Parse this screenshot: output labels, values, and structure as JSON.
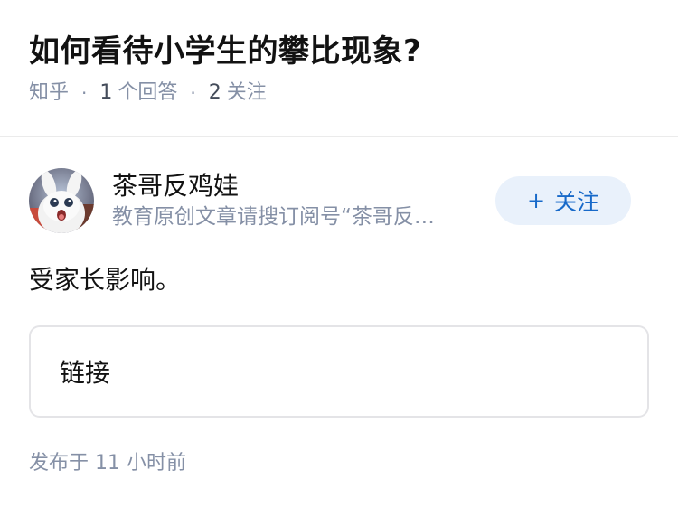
{
  "question": {
    "title": "如何看待小学生的攀比现象?",
    "source": "知乎",
    "answer_count": "1",
    "answer_label": "个回答",
    "follower_count": "2",
    "follower_label": "关注"
  },
  "answer": {
    "author": {
      "name": "茶哥反鸡娃",
      "headline": "教育原创文章请搜订阅号“茶哥反…",
      "avatar": "white-bunny-avatar"
    },
    "follow_button": {
      "icon": "plus-icon",
      "label": "关注",
      "color": "#1769c9",
      "background": "#e9f1fb"
    },
    "content": "受家长影响。",
    "link_card": {
      "label": "链接"
    },
    "publish": {
      "prefix": "发布于",
      "time": "11 小时前"
    }
  }
}
